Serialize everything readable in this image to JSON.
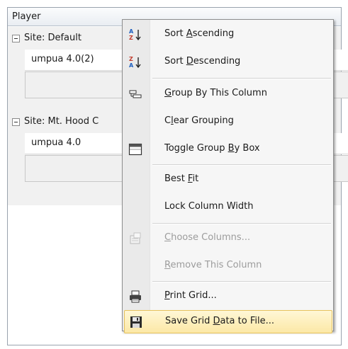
{
  "grid": {
    "column_header": "Player",
    "groups": [
      {
        "label": "Site: Default",
        "row_value": "umpua 4.0(2)"
      },
      {
        "label": "Site: Mt. Hood C",
        "row_value": "umpua 4.0"
      }
    ]
  },
  "context_menu": {
    "items": [
      {
        "id": "sort-ascending",
        "pre": "Sort ",
        "u": "A",
        "post": "scending",
        "icon": "sort-ascending-icon",
        "enabled": true
      },
      {
        "id": "sort-descending",
        "pre": "Sort ",
        "u": "D",
        "post": "escending",
        "icon": "sort-descending-icon",
        "enabled": true
      },
      {
        "id": "group-by-column",
        "pre": "",
        "u": "G",
        "post": "roup By This Column",
        "icon": "group-by-icon",
        "enabled": true
      },
      {
        "id": "clear-grouping",
        "pre": "C",
        "u": "l",
        "post": "ear Grouping",
        "icon": "",
        "enabled": true
      },
      {
        "id": "toggle-group-by-box",
        "pre": "Toggle Group ",
        "u": "B",
        "post": "y Box",
        "icon": "group-box-icon",
        "enabled": true
      },
      {
        "id": "best-fit",
        "pre": "Best ",
        "u": "F",
        "post": "it",
        "icon": "",
        "enabled": true
      },
      {
        "id": "lock-column-width",
        "pre": "Lock Column Width",
        "u": "",
        "post": "",
        "icon": "",
        "enabled": true
      },
      {
        "id": "choose-columns",
        "pre": "",
        "u": "C",
        "post": "hoose Columns...",
        "icon": "choose-columns-icon",
        "enabled": false
      },
      {
        "id": "remove-this-column",
        "pre": "",
        "u": "R",
        "post": "emove This Column",
        "icon": "",
        "enabled": false
      },
      {
        "id": "print-grid",
        "pre": "",
        "u": "P",
        "post": "rint Grid...",
        "icon": "printer-icon",
        "enabled": true
      },
      {
        "id": "save-grid-data",
        "pre": "Save Grid ",
        "u": "D",
        "post": "ata to File...",
        "icon": "floppy-disk-icon",
        "enabled": true,
        "highlighted": true
      }
    ]
  },
  "colors": {
    "highlight_fill": "#fce8a6",
    "highlight_border": "#e6c25c",
    "disabled_text": "#9c9c9c"
  }
}
